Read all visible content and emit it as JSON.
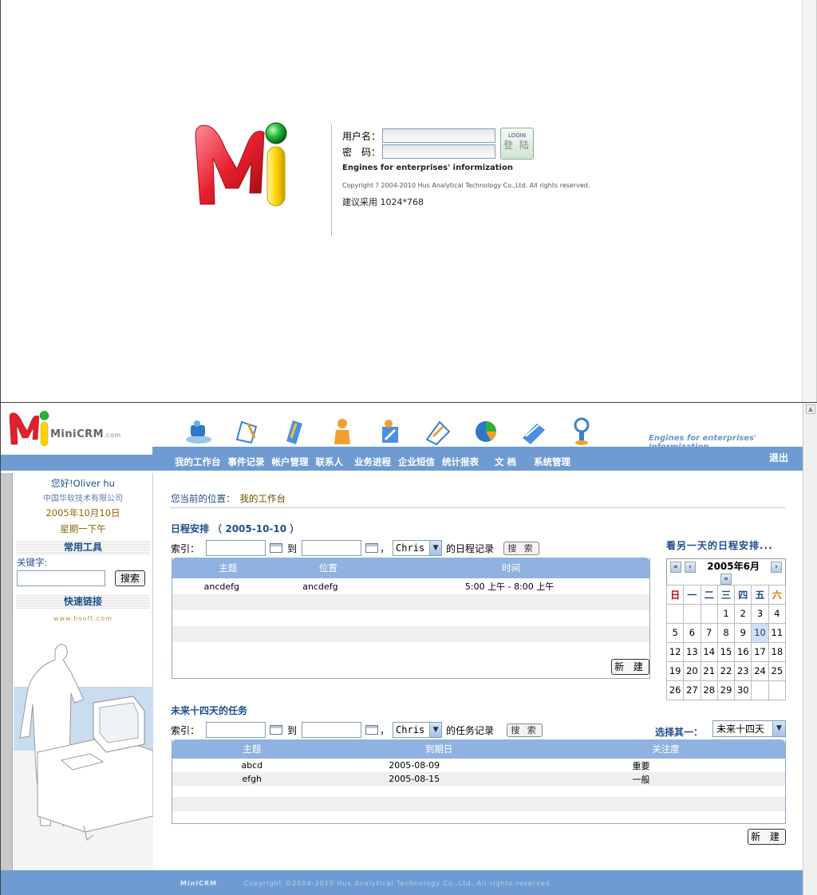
{
  "login": {
    "username_label": "用户名：",
    "password_label": "密　码：",
    "button_en": "LOGIN",
    "button_cn": "登 陆",
    "tagline": "Engines for enterprises' informization",
    "copyright": "Copyright ? 2004-2010 Hus Analytical Technology Co.,Ltd. All rights reserved.",
    "recommend": "建议采用 1024*768"
  },
  "app": {
    "logo_text": "MiniCRM",
    "logo_com": ".com",
    "header_tagline": "Engines for enterprises' informization",
    "nav": [
      "我的工作台",
      "事件记录",
      "帐户管理",
      "联系人",
      "业务进程",
      "企业短信",
      "统计报表",
      "文 档",
      "系统管理"
    ],
    "logout": "退出",
    "sidebar": {
      "greeting": "您好!Oliver hu",
      "company": "中国华软技术有限公司",
      "date": "2005年10月10日",
      "weekday": "星期一下午",
      "tools_head": "常用工具",
      "keyword_label": "关键字:",
      "search_btn": "搜索",
      "links_head": "快速链接",
      "link": "www.hsoft.com"
    },
    "breadcrumb": {
      "label": "您当前的位置：",
      "current": "我的工作台"
    },
    "schedule": {
      "title": "日程安排 （ 2005-10-10 ）",
      "index_label": "索引：",
      "to_label": "到",
      "person": "Chris",
      "records_label": "的日程记录",
      "search_btn": "搜 索",
      "columns": [
        "主题",
        "位置",
        "时间"
      ],
      "rows": [
        {
          "subject": "ancdefg",
          "location": "ancdefg",
          "time": "5:00 上午 - 8:00 上午"
        }
      ],
      "new_btn": "新 建"
    },
    "calendar": {
      "title": "看另一天的日程安排...",
      "month_label": "2005年6月",
      "weekdays": [
        "日",
        "一",
        "二",
        "三",
        "四",
        "五",
        "六"
      ],
      "weeks": [
        [
          "",
          "",
          "",
          "1",
          "2",
          "3",
          "4"
        ],
        [
          "5",
          "6",
          "7",
          "8",
          "9",
          "10",
          "11"
        ],
        [
          "12",
          "13",
          "14",
          "15",
          "16",
          "17",
          "18"
        ],
        [
          "19",
          "20",
          "21",
          "22",
          "23",
          "24",
          "25"
        ],
        [
          "26",
          "27",
          "28",
          "29",
          "30",
          "",
          ""
        ]
      ],
      "today": "10"
    },
    "tasks": {
      "title": "未来十四天的任务",
      "index_label": "索引：",
      "to_label": "到",
      "person": "Chris",
      "records_label": "的任务记录",
      "search_btn": "搜 索",
      "select_label": "选择其一：",
      "select_value": "未来十四天",
      "columns": [
        "主题",
        "到期日",
        "关注度"
      ],
      "rows": [
        {
          "subject": "abcd",
          "due": "2005-08-09",
          "priority": "重要"
        },
        {
          "subject": "efgh",
          "due": "2005-08-15",
          "priority": "一般"
        }
      ],
      "new_btn": "新 建"
    },
    "footer": {
      "brand": "MiniCRM",
      "text": "Copyright ©2004-2010 Hus Analytical Technology Co.,Ltd. All rights reserved."
    }
  }
}
